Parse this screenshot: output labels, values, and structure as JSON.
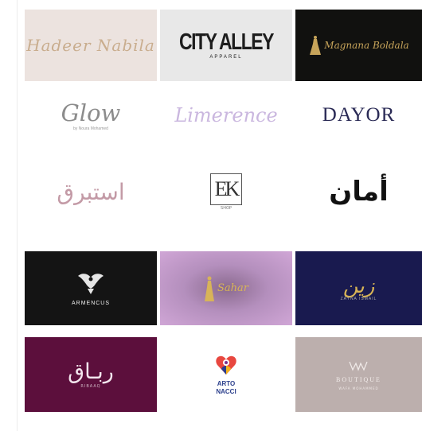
{
  "logos": [
    {
      "text": "Hadeer Nabila"
    },
    {
      "text": "CITY ALLEY",
      "sub": "APPAREL"
    },
    {
      "text": "Magnana Boldala"
    },
    {
      "text": "Glow",
      "sub": "by Noura Mohamed"
    },
    {
      "text": "Limerence"
    },
    {
      "text": "DAYOR"
    },
    {
      "text": "استبرق"
    },
    {
      "text": "EK",
      "sub": "SHOP"
    },
    {
      "text": "أمان"
    },
    {
      "text": "ARMENCUS"
    },
    {
      "text": "Sahar"
    },
    {
      "text": "زين",
      "sub": "ZAYNA ISMAIL"
    },
    {
      "text": "ربـاق",
      "sub": "RIBAAQ"
    },
    {
      "text": "ARTO",
      "sub": "NACCI"
    },
    {
      "text": "BOUTIQUE",
      "mark": "WM",
      "sub": "WAFA MOHAMMED"
    }
  ],
  "colors": {
    "page": "#ffffff",
    "gold": "#c7a45a",
    "burgundy": "#5c0f3c",
    "navy": "#191a4f"
  }
}
